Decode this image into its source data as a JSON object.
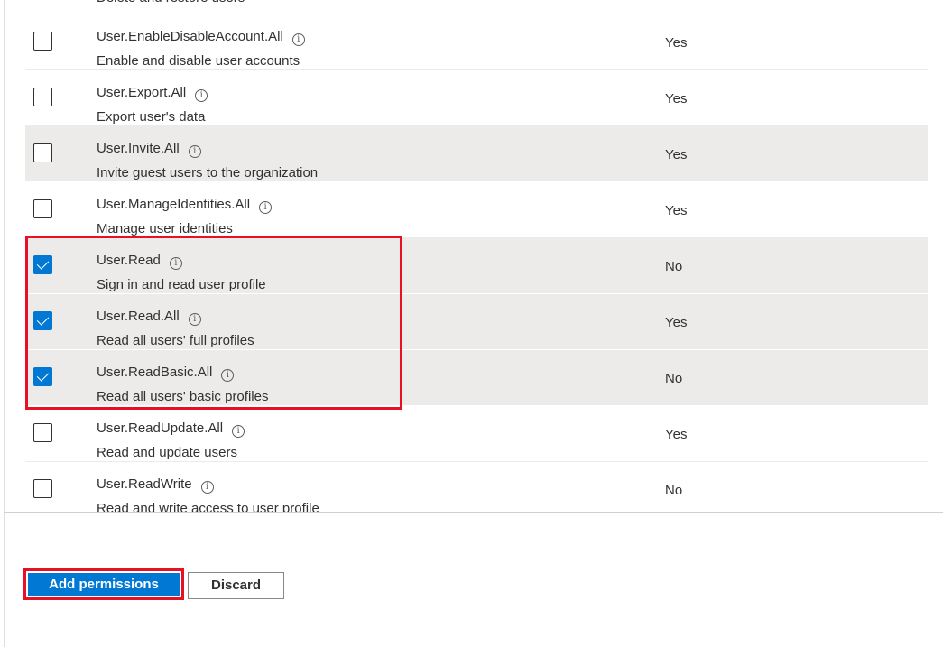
{
  "top_partial_text": "Delete and restore users",
  "permissions": [
    {
      "name": "User.EnableDisableAccount.All",
      "description": "Enable and disable user accounts",
      "admin_consent": "Yes",
      "checked": false
    },
    {
      "name": "User.Export.All",
      "description": "Export user's data",
      "admin_consent": "Yes",
      "checked": false
    },
    {
      "name": "User.Invite.All",
      "description": "Invite guest users to the organization",
      "admin_consent": "Yes",
      "checked": false
    },
    {
      "name": "User.ManageIdentities.All",
      "description": "Manage user identities",
      "admin_consent": "Yes",
      "checked": false
    },
    {
      "name": "User.Read",
      "description": "Sign in and read user profile",
      "admin_consent": "No",
      "checked": true
    },
    {
      "name": "User.Read.All",
      "description": "Read all users' full profiles",
      "admin_consent": "Yes",
      "checked": true
    },
    {
      "name": "User.ReadBasic.All",
      "description": "Read all users' basic profiles",
      "admin_consent": "No",
      "checked": true
    },
    {
      "name": "User.ReadUpdate.All",
      "description": "Read and update users",
      "admin_consent": "Yes",
      "checked": false
    },
    {
      "name": "User.ReadWrite",
      "description": "Read and write access to user profile",
      "admin_consent": "No",
      "checked": false
    }
  ],
  "icons": {
    "info": "info-icon",
    "checkmark": "checkmark-icon"
  },
  "colors": {
    "accent": "#0078d4",
    "highlight": "#e81123",
    "row_shade": "#edebe9"
  },
  "footer": {
    "add_label": "Add permissions",
    "discard_label": "Discard"
  }
}
